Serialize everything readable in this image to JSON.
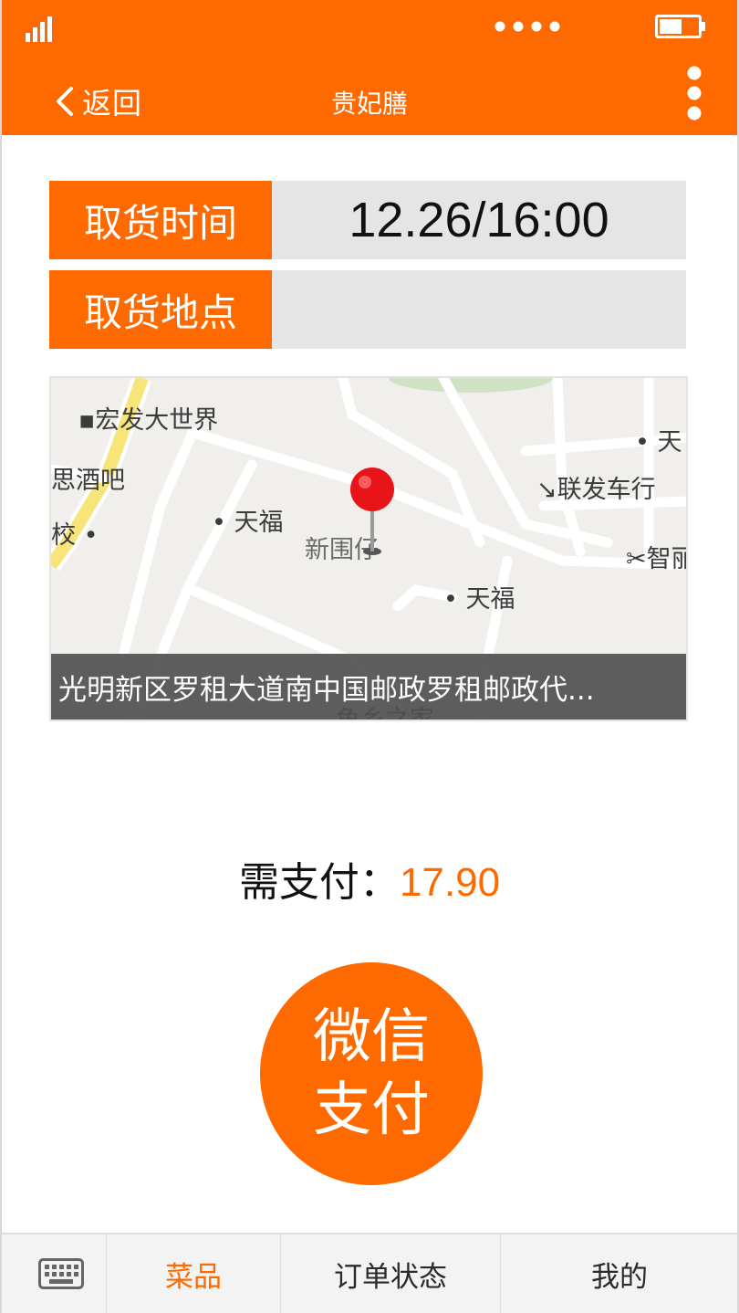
{
  "header": {
    "back_label": "返回",
    "title": "贵妃膳"
  },
  "pickup": {
    "time_label": "取货时间",
    "time_value": "12.26/16:00",
    "place_label": "取货地点",
    "place_value": ""
  },
  "map": {
    "labels": {
      "hongfa": "宏发大世界",
      "jiuba": "思酒吧",
      "jiao": "校",
      "tianfu_1": "天福",
      "xinweizi": "新围仔",
      "tianfu_2": "天福",
      "lianfa": "联发车行",
      "tian": "天",
      "zhili": "智丽",
      "yuxiang": "鱼乡之家"
    },
    "address": "光明新区罗租大道南中国邮政罗租邮政代..."
  },
  "payment": {
    "label": "需支付：",
    "amount": "17.90",
    "button_line1": "微信",
    "button_line2": "支付"
  },
  "tabbar": {
    "tabs": [
      {
        "label": "菜品",
        "active": true
      },
      {
        "label": "订单状态",
        "active": false
      },
      {
        "label": "我的",
        "active": false
      }
    ]
  },
  "icons": {
    "signal": "signal-icon",
    "dots": "carrier-dots-icon",
    "battery": "battery-icon",
    "back": "chevron-left-icon",
    "more": "more-vertical-icon",
    "pin": "map-pin-icon",
    "keyboard": "keyboard-icon"
  },
  "colors": {
    "accent": "#fe6a00",
    "value_bg": "#e5e5e5",
    "map_bg": "#f0efec"
  }
}
